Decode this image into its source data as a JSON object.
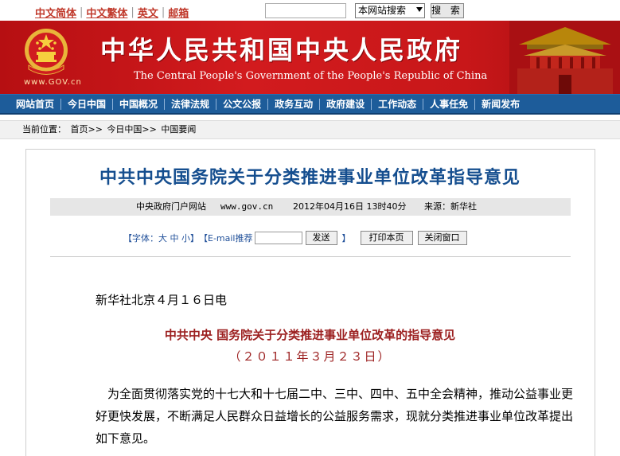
{
  "top_links": [
    "中文简体",
    "中文繁体",
    "英文",
    "邮箱"
  ],
  "search": {
    "scope": "本网站搜索",
    "button": "搜 索"
  },
  "banner": {
    "title": "中华人民共和国中央人民政府",
    "subtitle": "The Central People's Government of the People's Republic of China",
    "url": "www.GOV.cn"
  },
  "nav": [
    "网站首页",
    "今日中国",
    "中国概况",
    "法律法规",
    "公文公报",
    "政务互动",
    "政府建设",
    "工作动态",
    "人事任免",
    "新闻发布"
  ],
  "breadcrumb": {
    "label": "当前位置：",
    "items": [
      "首页>>",
      "今日中国>>",
      "中国要闻"
    ]
  },
  "article": {
    "title": "中共中央国务院关于分类推进事业单位改革指导意见",
    "source_site": "中央政府门户网站",
    "domain": "www.gov.cn",
    "datetime": "2012年04月16日 13时40分",
    "source": "来源：新华社",
    "tools": {
      "font_label": "【字体：大 中 小】",
      "email_label": "【E-mail推荐",
      "send": "发送",
      "close_bracket": "】",
      "print": "打印本页",
      "close": "关闭窗口"
    },
    "dateline": "新华社北京４月１６日电",
    "sub_title": "中共中央 国务院关于分类推进事业单位改革的指导意见",
    "sub_date": "（２０１１年３月２３日）",
    "paragraph": "为全面贯彻落实党的十七大和十七届二中、三中、四中、五中全会精神，推动公益事业更好更快发展，不断满足人民群众日益增长的公益服务需求，现就分类推进事业单位改革提出如下意见。"
  },
  "colors": {
    "banner_red": "#c81719",
    "nav_blue": "#1d5c9a",
    "title_blue": "#154e8f",
    "subtitle_red": "#9c2020"
  }
}
